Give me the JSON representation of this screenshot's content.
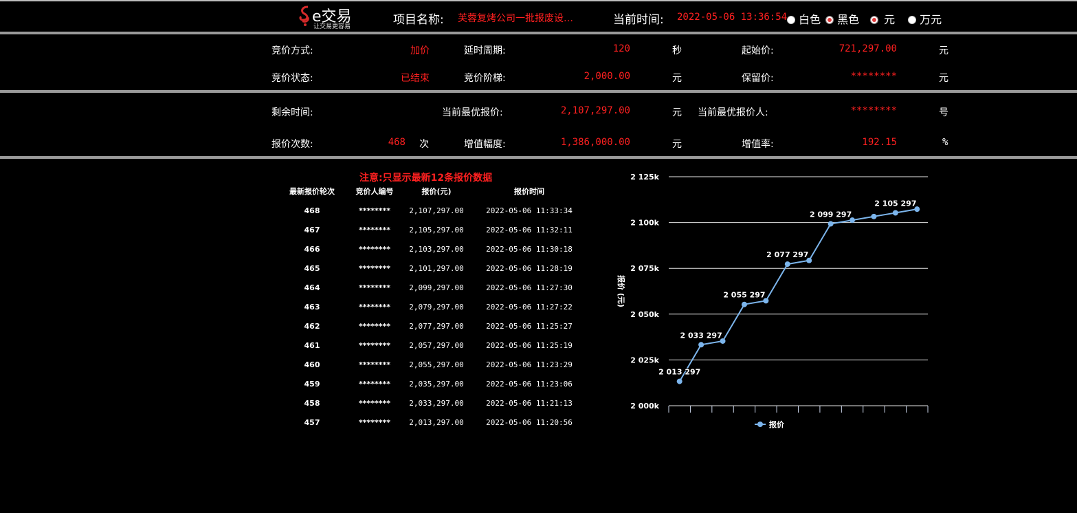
{
  "header": {
    "logo_text": "e交易",
    "logo_slogan": "让交易更容易",
    "project_label": "项目名称:",
    "project_name": "芙蓉复烤公司一批报废设…",
    "time_label": "当前时间:",
    "current_time": "2022-05-06 13:36:54",
    "theme_options": [
      {
        "label": "白色",
        "selected": false
      },
      {
        "label": "黑色",
        "selected": true
      }
    ],
    "unit_options": [
      {
        "label": "元",
        "selected": true
      },
      {
        "label": "万元",
        "selected": false
      }
    ]
  },
  "info": {
    "bid_mode_label": "竞价方式:",
    "bid_mode": "加价",
    "delay_label": "延时周期:",
    "delay": "120",
    "delay_unit": "秒",
    "start_price_label": "起始价:",
    "start_price": "721,297.00",
    "start_price_unit": "元",
    "status_label": "竞价状态:",
    "status": "已结束",
    "step_label": "竞价阶梯:",
    "step": "2,000.00",
    "step_unit": "元",
    "reserve_label": "保留价:",
    "reserve": "********",
    "reserve_unit": "元"
  },
  "live": {
    "remaining_label": "剩余时间:",
    "remaining": "",
    "best_price_label": "当前最优报价:",
    "best_price": "2,107,297.00",
    "best_price_unit": "元",
    "best_bidder_label": "当前最优报价人:",
    "best_bidder": "********",
    "best_bidder_unit": "号",
    "count_label": "报价次数:",
    "count": "468",
    "count_unit": "次",
    "increase_label": "增值幅度:",
    "increase": "1,386,000.00",
    "increase_unit": "元",
    "rate_label": "增值率:",
    "rate": "192.15",
    "rate_unit": "%"
  },
  "table": {
    "notice": "注意:只显示最新12条报价数据",
    "headers": [
      "最新报价轮次",
      "竞价人编号",
      "报价(元)",
      "报价时间"
    ],
    "rows": [
      [
        "468",
        "********",
        "2,107,297.00",
        "2022-05-06 11:33:34"
      ],
      [
        "467",
        "********",
        "2,105,297.00",
        "2022-05-06 11:32:11"
      ],
      [
        "466",
        "********",
        "2,103,297.00",
        "2022-05-06 11:30:18"
      ],
      [
        "465",
        "********",
        "2,101,297.00",
        "2022-05-06 11:28:19"
      ],
      [
        "464",
        "********",
        "2,099,297.00",
        "2022-05-06 11:27:30"
      ],
      [
        "463",
        "********",
        "2,079,297.00",
        "2022-05-06 11:27:22"
      ],
      [
        "462",
        "********",
        "2,077,297.00",
        "2022-05-06 11:25:27"
      ],
      [
        "461",
        "********",
        "2,057,297.00",
        "2022-05-06 11:25:19"
      ],
      [
        "460",
        "********",
        "2,055,297.00",
        "2022-05-06 11:23:29"
      ],
      [
        "459",
        "********",
        "2,035,297.00",
        "2022-05-06 11:23:06"
      ],
      [
        "458",
        "********",
        "2,033,297.00",
        "2022-05-06 11:21:13"
      ],
      [
        "457",
        "********",
        "2,013,297.00",
        "2022-05-06 11:20:56"
      ]
    ]
  },
  "chart_data": {
    "type": "line",
    "ylabel": "报价 (元)",
    "ylim": [
      2000000,
      2125000
    ],
    "yticks": [
      2000000,
      2025000,
      2050000,
      2075000,
      2100000,
      2125000
    ],
    "ytick_labels": [
      "2 000k",
      "2 025k",
      "2 050k",
      "2 075k",
      "2 100k",
      "2 125k"
    ],
    "grid": true,
    "legend_position": "bottom",
    "color": "#7cb5ec",
    "series": [
      {
        "name": "报价",
        "values": [
          2013297,
          2033297,
          2035297,
          2055297,
          2057297,
          2077297,
          2079297,
          2099297,
          2101297,
          2103297,
          2105297,
          2107297
        ],
        "data_labels": [
          "2 013 297",
          "2 033 297",
          null,
          "2 055 297",
          null,
          "2 077 297",
          null,
          "2 099 297",
          null,
          null,
          "2 105 297",
          null
        ]
      }
    ]
  }
}
